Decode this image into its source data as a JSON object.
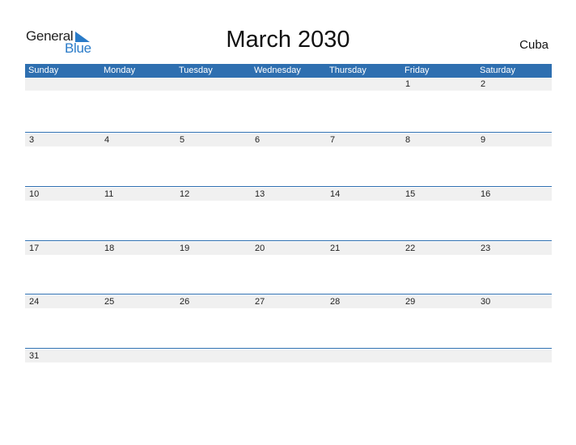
{
  "logo": {
    "line1": "General",
    "line2": "Blue"
  },
  "title": "March 2030",
  "country": "Cuba",
  "colors": {
    "header": "#2e6fb0",
    "logo_blue": "#2a7bc8",
    "strip": "#f0f0f0"
  },
  "weekdays": [
    "Sunday",
    "Monday",
    "Tuesday",
    "Wednesday",
    "Thursday",
    "Friday",
    "Saturday"
  ],
  "weeks": [
    [
      "",
      "",
      "",
      "",
      "",
      "1",
      "2"
    ],
    [
      "3",
      "4",
      "5",
      "6",
      "7",
      "8",
      "9"
    ],
    [
      "10",
      "11",
      "12",
      "13",
      "14",
      "15",
      "16"
    ],
    [
      "17",
      "18",
      "19",
      "20",
      "21",
      "22",
      "23"
    ],
    [
      "24",
      "25",
      "26",
      "27",
      "28",
      "29",
      "30"
    ],
    [
      "31",
      "",
      "",
      "",
      "",
      "",
      ""
    ]
  ]
}
